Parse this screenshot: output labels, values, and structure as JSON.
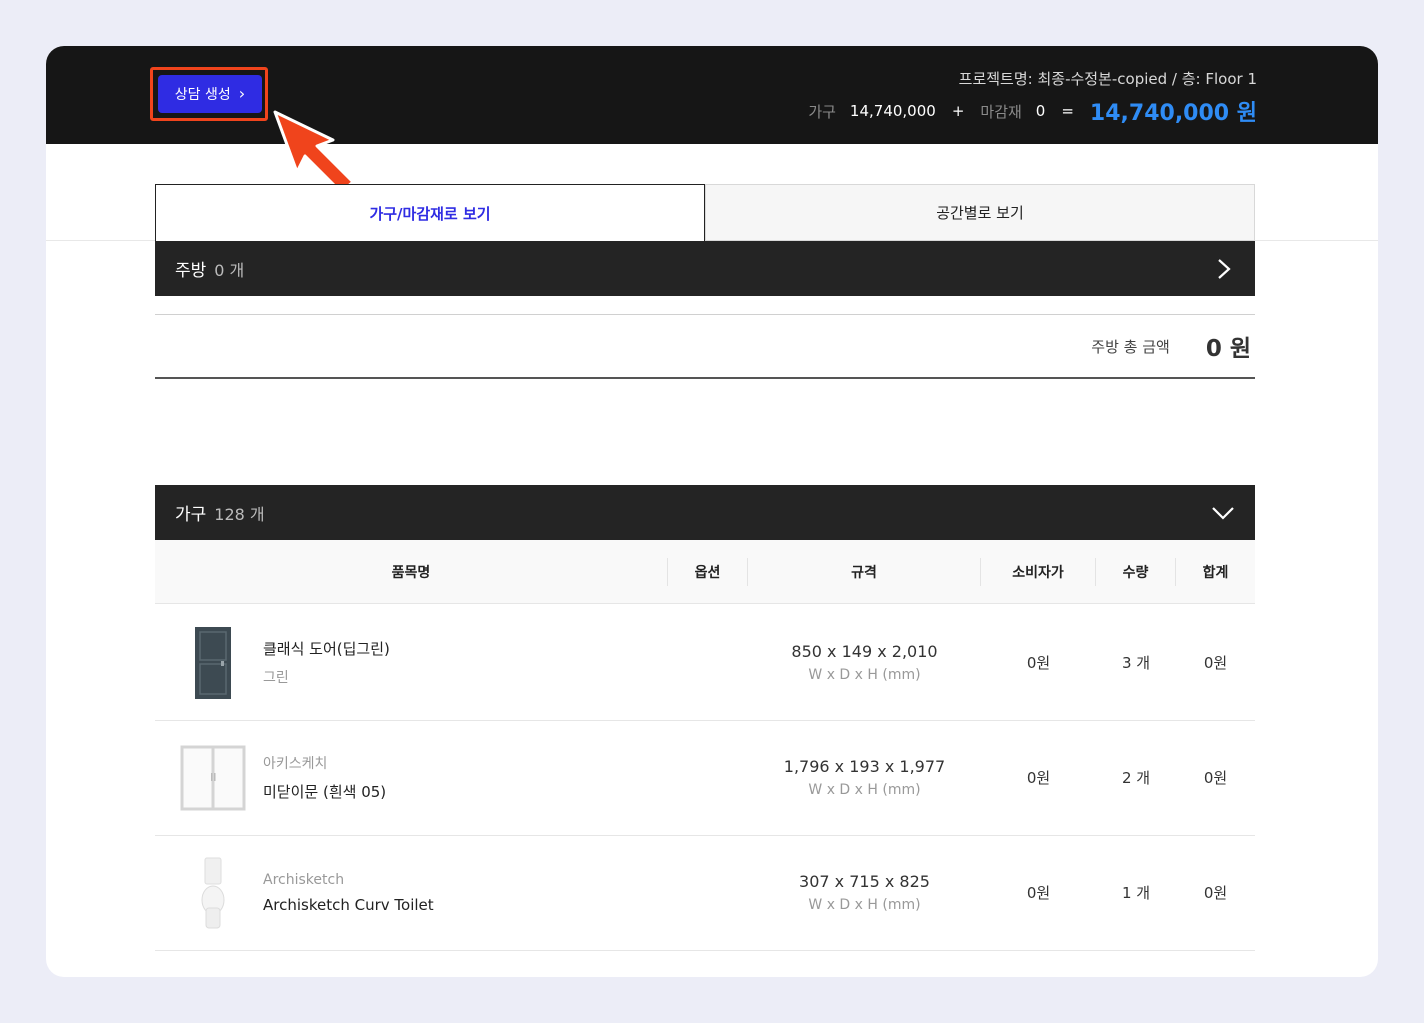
{
  "header": {
    "consult_button_label": "상담 생성",
    "project_info": "프로젝트명: 최종-수정본-copied / 층: Floor 1",
    "furniture_label": "가구",
    "furniture_value": "14,740,000",
    "plus": "+",
    "finish_label": "마감재",
    "finish_value": "0",
    "equals": "=",
    "total": "14,740,000 원"
  },
  "tabs": [
    {
      "label": "가구/마감재로 보기"
    },
    {
      "label": "공간별로 보기"
    }
  ],
  "kitchen": {
    "title": "주방",
    "count": "0 개",
    "total_label": "주방 총 금액",
    "total_value": "0 원"
  },
  "furniture": {
    "title": "가구",
    "count": "128 개"
  },
  "table": {
    "headers": [
      "품목명",
      "옵션",
      "규격",
      "소비자가",
      "수량",
      "합계"
    ],
    "rows": [
      {
        "line1": "클래식 도어(딥그린)",
        "line2": "그린",
        "dims": "850 x 149 x 2,010",
        "unit": "W x D x H (mm)",
        "price": "0원",
        "qty": "3 개",
        "sum": "0원"
      },
      {
        "line1": "아키스케치",
        "line2": "미닫이문 (흰색 05)",
        "dims": "1,796 x 193 x 1,977",
        "unit": "W x D x H (mm)",
        "price": "0원",
        "qty": "2 개",
        "sum": "0원"
      },
      {
        "line1": "Archisketch",
        "line2": "Archisketch Curv Toilet",
        "dims": "307 x 715 x 825",
        "unit": "W x D x H (mm)",
        "price": "0원",
        "qty": "1 개",
        "sum": "0원"
      }
    ]
  },
  "colors": {
    "accent_blue": "#2f2ce3",
    "total_blue": "#2f8cf5",
    "highlight_red": "#f0441c",
    "bar_dark": "#242424"
  }
}
